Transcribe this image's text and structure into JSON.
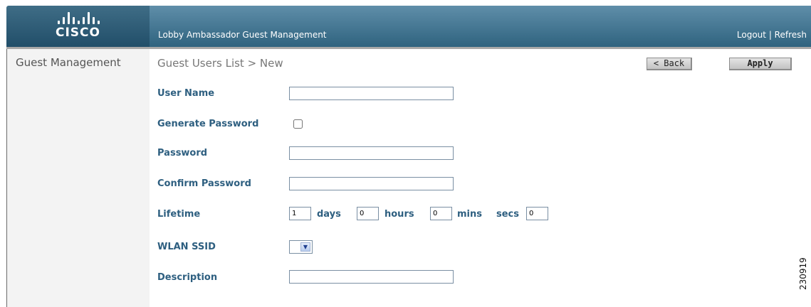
{
  "header": {
    "logo_text": "CISCO",
    "app_title": "Lobby Ambassador Guest Management",
    "logout_label": "Logout",
    "separator": " | ",
    "refresh_label": "Refresh"
  },
  "sidebar": {
    "items": [
      {
        "label": "Guest Management"
      }
    ]
  },
  "breadcrumb": "Guest Users List > New",
  "toolbar": {
    "back_label": "< Back",
    "apply_label": "Apply"
  },
  "form": {
    "user_name": {
      "label": "User Name",
      "value": ""
    },
    "generate_password": {
      "label": "Generate Password",
      "checked": false
    },
    "password": {
      "label": "Password",
      "value": ""
    },
    "confirm_password": {
      "label": "Confirm Password",
      "value": ""
    },
    "lifetime": {
      "label": "Lifetime",
      "days": {
        "value": "1",
        "unit": "days"
      },
      "hours": {
        "value": "0",
        "unit": "hours"
      },
      "mins": {
        "value": "0",
        "unit": "mins"
      },
      "secs": {
        "value": "0",
        "unit": "secs"
      }
    },
    "wlan_ssid": {
      "label": "WLAN SSID",
      "value": ""
    },
    "description": {
      "label": "Description",
      "value": ""
    }
  },
  "figure_id": "230919",
  "colors": {
    "header_dark": "#214e69",
    "header_light": "#5f8ea9",
    "label_blue": "#2e5f80",
    "sidebar_bg": "#f3f3f3"
  },
  "icons": {
    "logo": "cisco-bridge-logo-icon",
    "dropdown": "chevron-down-icon"
  }
}
